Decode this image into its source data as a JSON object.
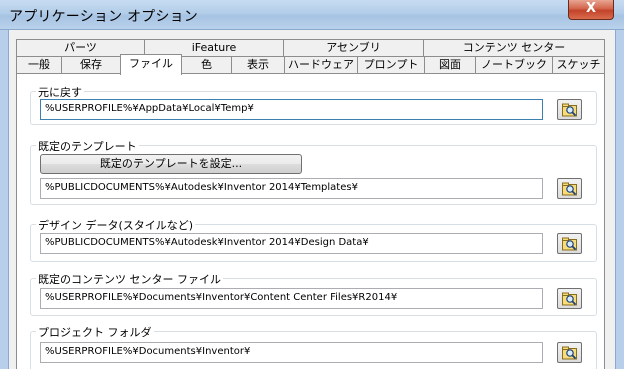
{
  "window": {
    "title": "アプリケーション オプション",
    "close_glyph": "X"
  },
  "tabs": {
    "row1": [
      "パーツ",
      "iFeature",
      "アセンブリ",
      "コンテンツ センター"
    ],
    "row2": [
      "一般",
      "保存",
      "ファイル",
      "色",
      "表示",
      "ハードウェア",
      "プロンプト",
      "図面",
      "ノートブック",
      "スケッチ"
    ],
    "active": "ファイル"
  },
  "groups": {
    "undo": {
      "label": "元に戻す",
      "path": "%USERPROFILE%¥AppData¥Local¥Temp¥"
    },
    "templates": {
      "label": "既定のテンプレート",
      "button": "既定のテンプレートを設定...",
      "path": "%PUBLICDOCUMENTS%¥Autodesk¥Inventor 2014¥Templates¥"
    },
    "design_data": {
      "label": "デザイン データ(スタイルなど)",
      "path": "%PUBLICDOCUMENTS%¥Autodesk¥Inventor 2014¥Design Data¥"
    },
    "content_center": {
      "label": "既定のコンテンツ センター ファイル",
      "path": "%USERPROFILE%¥Documents¥Inventor¥Content Center Files¥R2014¥"
    },
    "project": {
      "label": "プロジェクト フォルダ",
      "path": "%USERPROFILE%¥Documents¥Inventor¥"
    }
  },
  "icons": {
    "browse": "folder-magnifier-icon"
  }
}
